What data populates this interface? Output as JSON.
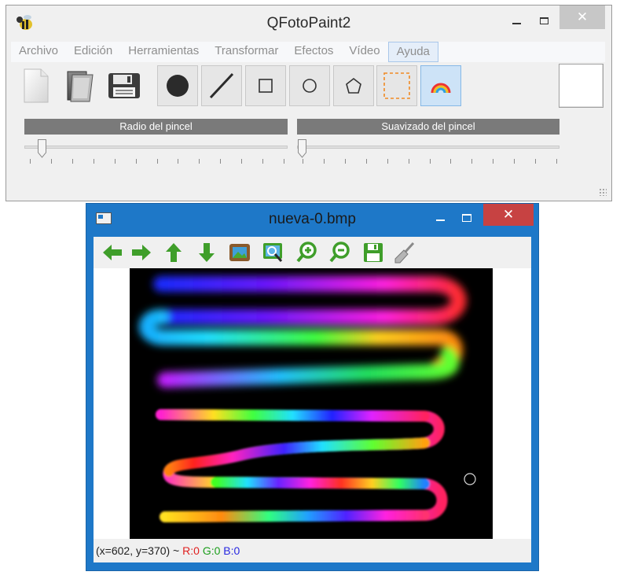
{
  "main_window": {
    "title": "QFotoPaint2",
    "close_label": "✕"
  },
  "menu": {
    "items": [
      "Archivo",
      "Edición",
      "Herramientas",
      "Transformar",
      "Efectos",
      "Vídeo",
      "Ayuda"
    ],
    "active_item": "Ayuda"
  },
  "toolbar": {
    "tools": [
      {
        "icon": "new-file-icon"
      },
      {
        "icon": "open-file-icon"
      },
      {
        "icon": "save-disk-icon"
      },
      {
        "icon": "point-tool-icon"
      },
      {
        "icon": "line-tool-icon"
      },
      {
        "icon": "rectangle-tool-icon"
      },
      {
        "icon": "ellipse-tool-icon"
      },
      {
        "icon": "polygon-tool-icon"
      },
      {
        "icon": "selection-tool-icon"
      },
      {
        "icon": "rainbow-tool-icon",
        "checked": true
      }
    ],
    "current_color": "#ffffff"
  },
  "sliders": {
    "brush_radius": {
      "label": "Radio del pincel",
      "value_fraction": 0.05
    },
    "brush_smoothing": {
      "label": "Suavizado del pincel",
      "value_fraction": 0.0
    }
  },
  "image_window": {
    "title": "nueva-0.bmp",
    "close_label": "✕",
    "toolbar_icons": [
      "arrow-left-icon",
      "arrow-right-icon",
      "arrow-up-icon",
      "arrow-down-icon",
      "picture-icon",
      "zoom-fit-icon",
      "zoom-in-icon",
      "zoom-out-icon",
      "save-icon",
      "brush-clear-icon"
    ]
  },
  "status": {
    "coords": "(x=602, y=370) ~ ",
    "r": "R:0",
    "g": "G:0",
    "b": "B:0"
  },
  "colors": {
    "canvas_background": "#000000",
    "titlebar_active": "#1e78c8",
    "close_active": "#c74242"
  }
}
